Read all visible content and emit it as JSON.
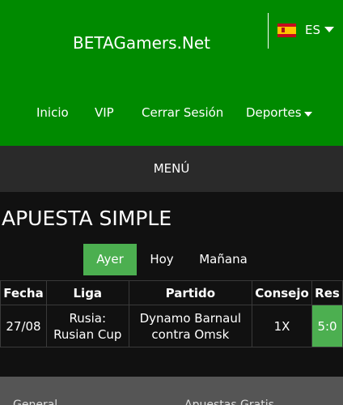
{
  "header": {
    "brand": "BETAGamers.Net",
    "language": {
      "code": "ES",
      "flag_icon": "spain-flag-icon"
    },
    "nav": [
      {
        "label": "Inicio"
      },
      {
        "label": "VIP"
      },
      {
        "label": "Cerrar Sesión"
      },
      {
        "label": "Deportes"
      }
    ]
  },
  "menu": {
    "label": "MENÚ"
  },
  "main": {
    "title": "APUESTA SIMPLE",
    "day_tabs": [
      {
        "label": "Ayer",
        "active": true
      },
      {
        "label": "Hoy",
        "active": false
      },
      {
        "label": "Mañana",
        "active": false
      }
    ],
    "table": {
      "headers": [
        "Fecha",
        "Liga",
        "Partido",
        "Consejo",
        "Res"
      ],
      "rows": [
        {
          "fecha": "27/08",
          "liga_line1": "Rusia:",
          "liga_line2": "Rusian Cup",
          "partido_line1": "Dynamo Barnaul",
          "partido_line2": "contra Omsk",
          "consejo": "1X",
          "res": "5:0"
        }
      ]
    }
  },
  "footer": {
    "links": [
      "General",
      "Apuestas Gratis"
    ]
  },
  "colors": {
    "header_green": "#008a00",
    "accent_green": "#4caf50",
    "menu_bar": "#2a2a2a",
    "background": "#111111",
    "footer": "#555555"
  }
}
